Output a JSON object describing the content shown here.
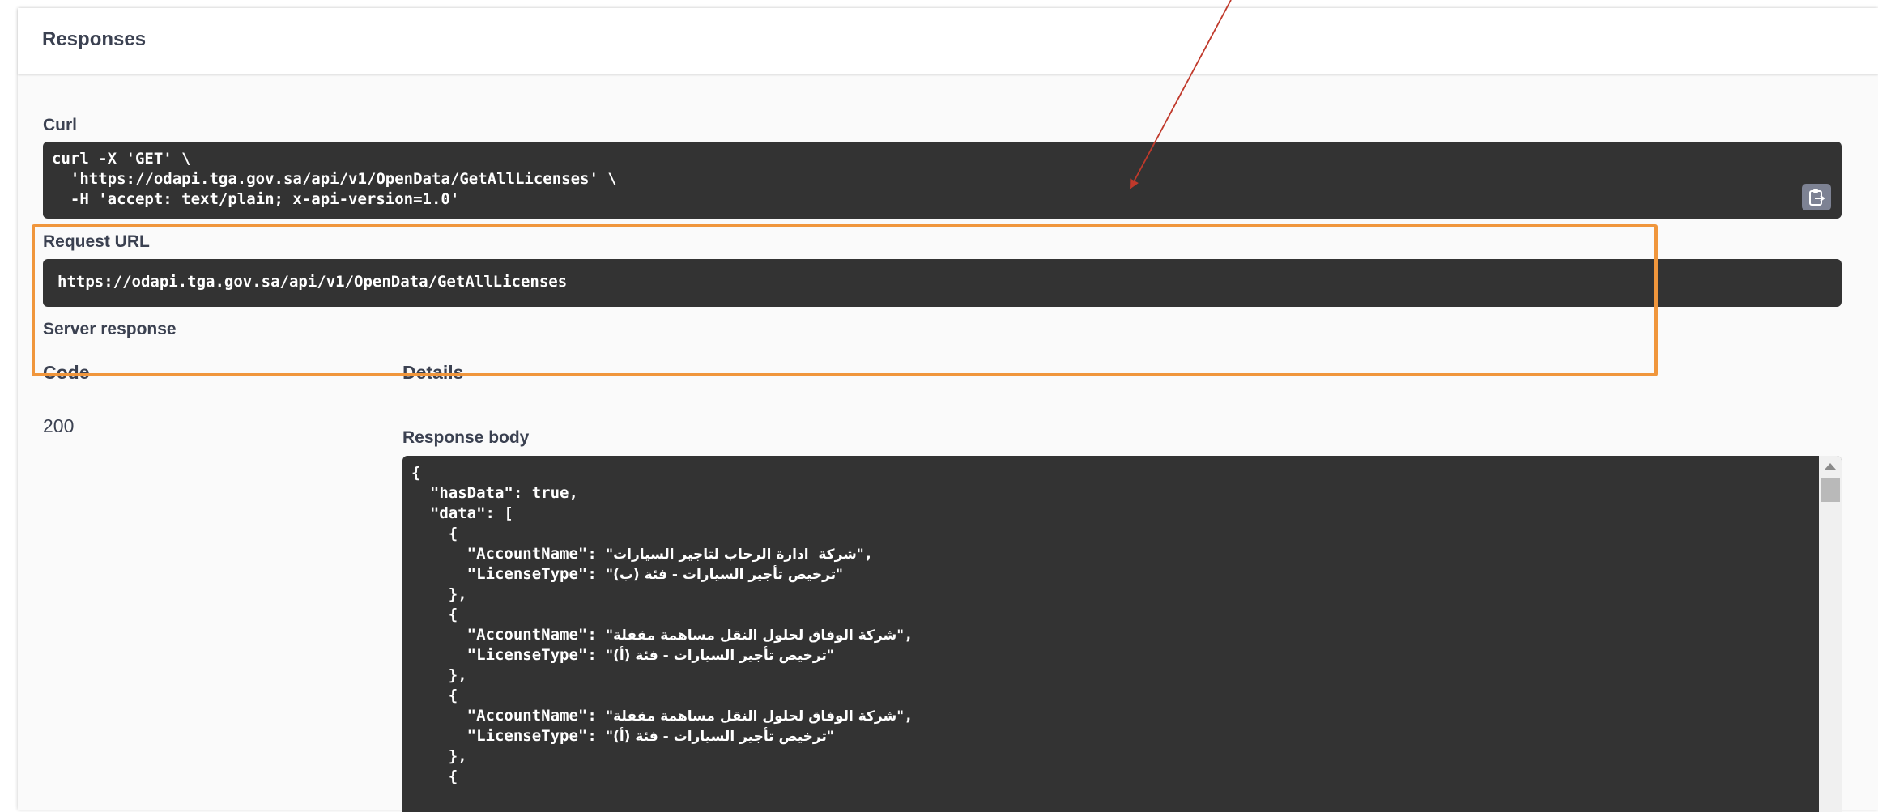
{
  "responses": {
    "title": "Responses"
  },
  "curl": {
    "label": "Curl",
    "command": "curl -X 'GET' \\\n  'https://odapi.tga.gov.sa/api/v1/OpenData/GetAllLicenses' \\\n  -H 'accept: text/plain; x-api-version=1.0'",
    "copy_icon": "clipboard-icon"
  },
  "request_url": {
    "label": "Request URL",
    "value": "https://odapi.tga.gov.sa/api/v1/OpenData/GetAllLicenses"
  },
  "server_response": {
    "label": "Server response",
    "col_code": "Code",
    "col_details": "Details",
    "code": "200",
    "body_label": "Response body",
    "lines": [
      {
        "indent": "",
        "key": "",
        "sep": "",
        "value": "{",
        "end": ""
      },
      {
        "indent": "  ",
        "key": "\"hasData\"",
        "sep": ": ",
        "value": "true",
        "end": ","
      },
      {
        "indent": "  ",
        "key": "\"data\"",
        "sep": ": ",
        "value": "[",
        "end": ""
      },
      {
        "indent": "    ",
        "key": "",
        "sep": "",
        "value": "{",
        "end": ""
      },
      {
        "indent": "      ",
        "key": "\"AccountName\"",
        "sep": ": ",
        "value": "\"شركة  ادارة الرحاب لتاجير السيارات\"",
        "end": ","
      },
      {
        "indent": "      ",
        "key": "\"LicenseType\"",
        "sep": ": ",
        "value": "\"ترخيص تأجير السيارات - فئة (ب)\"",
        "end": ""
      },
      {
        "indent": "    ",
        "key": "",
        "sep": "",
        "value": "},",
        "end": ""
      },
      {
        "indent": "    ",
        "key": "",
        "sep": "",
        "value": "{",
        "end": ""
      },
      {
        "indent": "      ",
        "key": "\"AccountName\"",
        "sep": ": ",
        "value": "\"شركة الوفاق لحلول النقل مساهمة مقفلة\"",
        "end": ","
      },
      {
        "indent": "      ",
        "key": "\"LicenseType\"",
        "sep": ": ",
        "value": "\"ترخيص تأجير السيارات - فئة (أ)\"",
        "end": ""
      },
      {
        "indent": "    ",
        "key": "",
        "sep": "",
        "value": "},",
        "end": ""
      },
      {
        "indent": "    ",
        "key": "",
        "sep": "",
        "value": "{",
        "end": ""
      },
      {
        "indent": "      ",
        "key": "\"AccountName\"",
        "sep": ": ",
        "value": "\"شركة الوفاق لحلول النقل مساهمة مقفلة\"",
        "end": ","
      },
      {
        "indent": "      ",
        "key": "\"LicenseType\"",
        "sep": ": ",
        "value": "\"ترخيص تأجير السيارات - فئة (أ)\"",
        "end": ""
      },
      {
        "indent": "    ",
        "key": "",
        "sep": "",
        "value": "},",
        "end": ""
      },
      {
        "indent": "    ",
        "key": "",
        "sep": "",
        "value": "{",
        "end": ""
      }
    ]
  },
  "annotations": {
    "box_color": "#f0963c",
    "arrow_color": "#c0392b"
  }
}
